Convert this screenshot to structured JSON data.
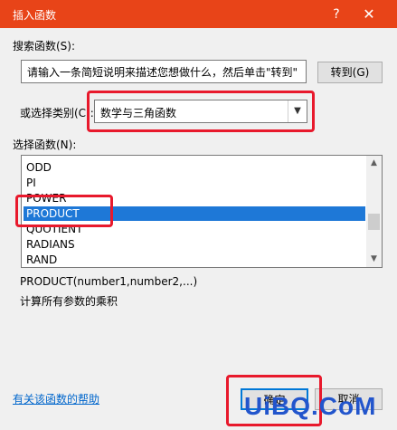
{
  "window": {
    "title": "插入函数",
    "help_glyph": "?",
    "close_glyph": "✕"
  },
  "search": {
    "label": "搜索函数(S):",
    "value": "请输入一条简短说明来描述您想做什么，然后单击\"转到\"",
    "go_label": "转到(G)"
  },
  "category": {
    "label": "或选择类别(C):",
    "value": "数学与三角函数"
  },
  "functions": {
    "label": "选择函数(N):",
    "items": [
      "ODD",
      "PI",
      "POWER",
      "PRODUCT",
      "QUOTIENT",
      "RADIANS",
      "RAND"
    ],
    "selected": "PRODUCT"
  },
  "selected_function": {
    "signature": "PRODUCT(number1,number2,...)",
    "description": "计算所有参数的乘积"
  },
  "footer": {
    "help_link": "有关该函数的帮助",
    "ok_label": "确定",
    "cancel_label": "取消"
  },
  "watermark": "UiBQ.CoM",
  "colors": {
    "titlebar": "#e84418",
    "selection": "#1e78d7",
    "highlight": "#e8192c"
  }
}
